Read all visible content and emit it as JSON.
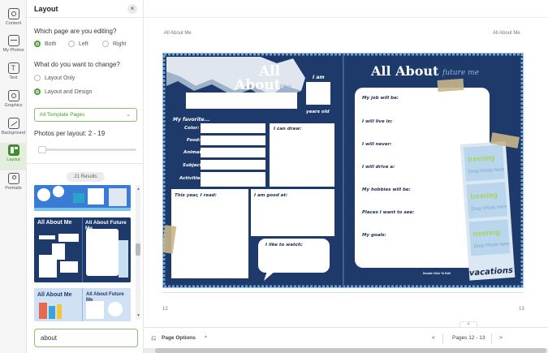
{
  "rail": {
    "items": [
      {
        "label": "Content"
      },
      {
        "label": "My Photos"
      },
      {
        "label": "Text"
      },
      {
        "label": "Graphics"
      },
      {
        "label": "Background"
      },
      {
        "label": "Layout"
      },
      {
        "label": "Portraits"
      }
    ]
  },
  "panel": {
    "title": "Layout",
    "close": "×",
    "page_question": "Which page are you editing?",
    "page_options": [
      "Both",
      "Left",
      "Right"
    ],
    "change_question": "What do you want to change?",
    "change_options": [
      "Layout Only",
      "Layout and Design"
    ],
    "dropdown_value": "All Template Pages",
    "photos_per_layout": "Photos per layout: 2 - 19",
    "results": "21 Results",
    "thumb2_title_left": "All About Me",
    "thumb2_title_right": "All About Future Me",
    "thumb3_title_left": "All About Me",
    "thumb3_title_right": "All About Future Me",
    "search_value": "about"
  },
  "main": {
    "left_page_label": "All About Me",
    "right_page_label": "All About Me",
    "left_page_number": "12",
    "right_page_number": "13",
    "page_options": "Page Options",
    "pages_label": "Pages 12 - 13",
    "prev": "<",
    "next": ">",
    "up": "^",
    "caret_up": "^"
  },
  "spread": {
    "left": {
      "title_line1": "All",
      "title_line2": "About",
      "title_me": "me",
      "i_am": "I am",
      "years_old": "years old",
      "favorites": "My favorite...",
      "fav_items": [
        "Color:",
        "Food:",
        "Animal:",
        "Subject:",
        "Activities:"
      ],
      "i_can_draw": "I can draw:",
      "this_year": "This year, I read:",
      "good_at": "I am good at:",
      "like_to_watch": "I like to watch:"
    },
    "right": {
      "title": "All About",
      "title_future": "future me",
      "prompts": [
        "My job will be:",
        "I will live in:",
        "I will never:",
        "I will drive a:",
        "My hobbies will be:",
        "Places I want to see:",
        "My goals:"
      ],
      "double_click": "Double Click To Edit",
      "vacations": "vacations",
      "treering": "treering",
      "drop_photo": "Drop Photo here"
    }
  },
  "colors": {
    "accent_green": "#4a9b2f",
    "navy": "#1d3a6b",
    "tape": "#c9b58a"
  }
}
